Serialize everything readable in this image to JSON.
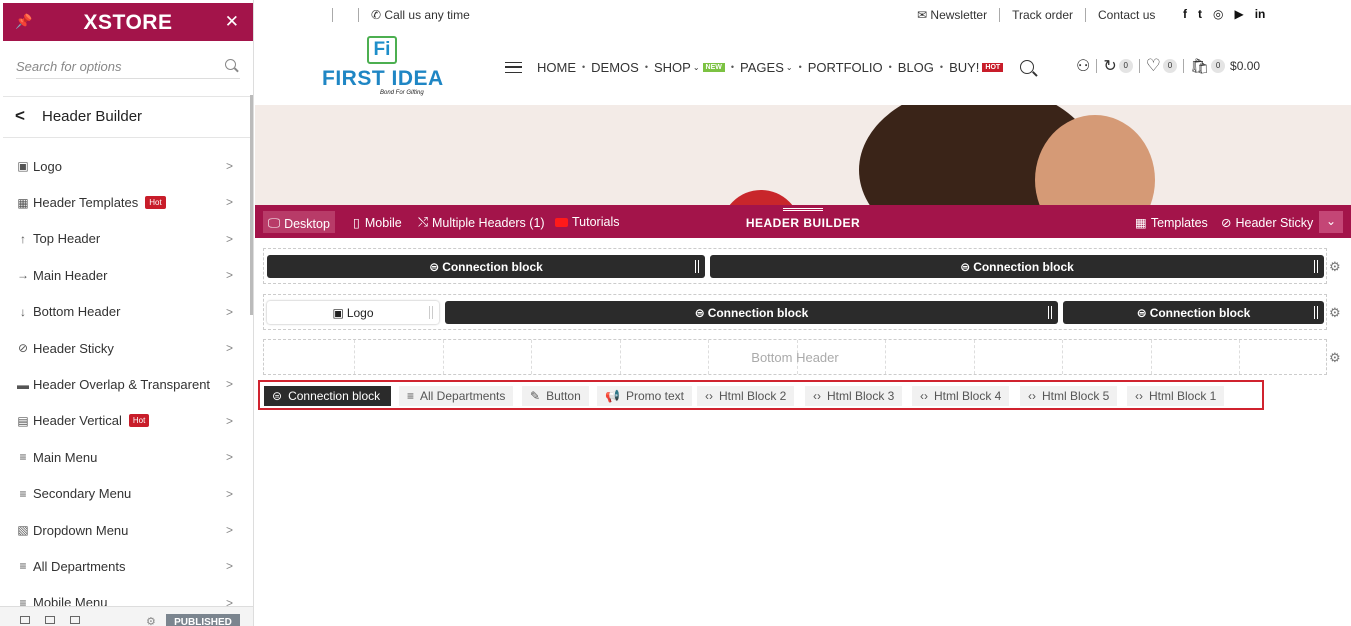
{
  "sidebar": {
    "brand": "XSTORE",
    "search_placeholder": "Search for options",
    "back_title": "Header Builder",
    "items": [
      {
        "icon": "image-icon",
        "glyph": "▣",
        "label": "Logo",
        "hot": ""
      },
      {
        "icon": "grid-icon",
        "glyph": "▦",
        "label": "Header Templates",
        "hot": "Hot"
      },
      {
        "icon": "arrow-up-icon",
        "glyph": "↑",
        "label": "Top Header",
        "hot": ""
      },
      {
        "icon": "arrow-right-icon",
        "glyph": "→",
        "label": "Main Header",
        "hot": ""
      },
      {
        "icon": "arrow-down-icon",
        "glyph": "↓",
        "label": "Bottom Header",
        "hot": ""
      },
      {
        "icon": "pin-icon",
        "glyph": "⊘",
        "label": "Header Sticky",
        "hot": ""
      },
      {
        "icon": "overlay-icon",
        "glyph": "▬",
        "label": "Header Overlap & Transparent",
        "hot": ""
      },
      {
        "icon": "vertical-icon",
        "glyph": "▤",
        "label": "Header Vertical",
        "hot": "Hot"
      },
      {
        "icon": "menu-icon",
        "glyph": "≡",
        "label": "Main Menu",
        "hot": ""
      },
      {
        "icon": "menu-icon",
        "glyph": "≡",
        "label": "Secondary Menu",
        "hot": ""
      },
      {
        "icon": "dropdown-icon",
        "glyph": "▧",
        "label": "Dropdown Menu",
        "hot": ""
      },
      {
        "icon": "menu-icon",
        "glyph": "≡",
        "label": "All Departments",
        "hot": ""
      },
      {
        "icon": "menu-icon",
        "glyph": "≡",
        "label": "Mobile Menu",
        "hot": ""
      }
    ],
    "footer_button": "PUBLISHED"
  },
  "topbar": {
    "call": "Call us any time",
    "newsletter": "Newsletter",
    "track": "Track order",
    "contact": "Contact us",
    "social": [
      "f",
      "t",
      "◎",
      "▶",
      "in"
    ]
  },
  "site": {
    "logo_mark": "Fi",
    "logo_name": "FIRST IDEA",
    "logo_tag": "Bond For Gifting",
    "nav": {
      "home": "HOME",
      "demos": "DEMOS",
      "shop": "SHOP",
      "new_badge": "NEW",
      "pages": "PAGES",
      "portfolio": "PORTFOLIO",
      "blog": "BLOG",
      "buy": "BUY!",
      "hot_badge": "HOT"
    },
    "compare_count": "0",
    "wishlist_count": "0",
    "cart_count": "0",
    "cart_total": "$0.00"
  },
  "builder": {
    "desktop": "Desktop",
    "mobile": "Mobile",
    "multiple": "Multiple Headers (1)",
    "tutorials": "Tutorials",
    "title": "HEADER BUILDER",
    "templates": "Templates",
    "sticky": "Header Sticky",
    "top_row": [
      "Connection block",
      "Connection block"
    ],
    "main_row": {
      "logo": "Logo",
      "blocks": [
        "Connection block",
        "Connection block"
      ]
    },
    "bottom_row_label": "Bottom Header",
    "pool": [
      "Connection block",
      "All Departments",
      "Button",
      "Promo text",
      "Html Block 2",
      "Html Block 3",
      "Html Block 4",
      "Html Block 5",
      "Html Block 1"
    ]
  },
  "colors": {
    "brand": "#a3144a",
    "hot": "#c81d2a",
    "new": "#7cc242",
    "logo_blue": "#1f86c4"
  }
}
